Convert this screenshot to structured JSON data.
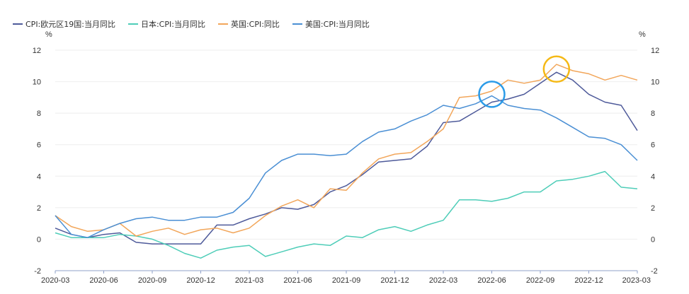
{
  "chart_data": {
    "type": "line",
    "title": "",
    "x": [
      "2020-03",
      "2020-04",
      "2020-05",
      "2020-06",
      "2020-07",
      "2020-08",
      "2020-09",
      "2020-10",
      "2020-11",
      "2020-12",
      "2021-01",
      "2021-02",
      "2021-03",
      "2021-04",
      "2021-05",
      "2021-06",
      "2021-07",
      "2021-08",
      "2021-09",
      "2021-10",
      "2021-11",
      "2021-12",
      "2022-01",
      "2022-02",
      "2022-03",
      "2022-04",
      "2022-05",
      "2022-06",
      "2022-07",
      "2022-08",
      "2022-09",
      "2022-10",
      "2022-11",
      "2022-12",
      "2023-01",
      "2023-02",
      "2023-03"
    ],
    "x_tick_labels": [
      "2020-03",
      "2020-06",
      "2020-09",
      "2020-12",
      "2021-03",
      "2021-06",
      "2021-09",
      "2021-12",
      "2022-03",
      "2022-06",
      "2022-09",
      "2022-12",
      "2023-03"
    ],
    "y_left_unit": "%",
    "y_right_unit": "%",
    "ylim": [
      -2,
      12
    ],
    "y_ticks": [
      -2,
      0,
      2,
      4,
      6,
      8,
      10,
      12
    ],
    "grid": "horizontal",
    "legend_position": "top-left",
    "series": [
      {
        "name": "CPI:欧元区19国:当月同比",
        "color": "#4e5a9a",
        "values": [
          0.7,
          0.3,
          0.1,
          0.3,
          0.4,
          -0.2,
          -0.3,
          -0.3,
          -0.3,
          -0.3,
          0.9,
          0.9,
          1.3,
          1.6,
          2.0,
          1.9,
          2.2,
          3.0,
          3.4,
          4.1,
          4.9,
          5.0,
          5.1,
          5.9,
          7.4,
          7.5,
          8.1,
          8.7,
          8.9,
          9.2,
          9.9,
          10.6,
          10.1,
          9.2,
          8.7,
          8.5,
          6.9
        ]
      },
      {
        "name": "日本:CPI:当月同比",
        "color": "#4ecdb8",
        "values": [
          0.4,
          0.1,
          0.1,
          0.1,
          0.3,
          0.2,
          0.0,
          -0.4,
          -0.9,
          -1.2,
          -0.7,
          -0.5,
          -0.4,
          -1.1,
          -0.8,
          -0.5,
          -0.3,
          -0.4,
          0.2,
          0.1,
          0.6,
          0.8,
          0.5,
          0.9,
          1.2,
          2.5,
          2.5,
          2.4,
          2.6,
          3.0,
          3.0,
          3.7,
          3.8,
          4.0,
          4.3,
          3.3,
          3.2
        ]
      },
      {
        "name": "英国:CPI:同比",
        "color": "#f2a65a",
        "values": [
          1.5,
          0.8,
          0.5,
          0.6,
          1.0,
          0.2,
          0.5,
          0.7,
          0.3,
          0.6,
          0.7,
          0.4,
          0.7,
          1.5,
          2.1,
          2.5,
          2.0,
          3.2,
          3.1,
          4.2,
          5.1,
          5.4,
          5.5,
          6.2,
          7.0,
          9.0,
          9.1,
          9.4,
          10.1,
          9.9,
          10.1,
          11.1,
          10.7,
          10.5,
          10.1,
          10.4,
          10.1
        ]
      },
      {
        "name": "美国:CPI:当月同比",
        "color": "#4a8fd4",
        "values": [
          1.5,
          0.3,
          0.1,
          0.6,
          1.0,
          1.3,
          1.4,
          1.2,
          1.2,
          1.4,
          1.4,
          1.7,
          2.6,
          4.2,
          5.0,
          5.4,
          5.4,
          5.3,
          5.4,
          6.2,
          6.8,
          7.0,
          7.5,
          7.9,
          8.5,
          8.3,
          8.6,
          9.1,
          8.5,
          8.3,
          8.2,
          7.7,
          7.1,
          6.5,
          6.4,
          6.0,
          5.0
        ]
      }
    ],
    "annotations": [
      {
        "shape": "circle",
        "color": "#2b9be8",
        "x": "2022-06",
        "y": 9.2
      },
      {
        "shape": "circle",
        "color": "#f5b916",
        "x": "2022-10",
        "y": 10.8
      }
    ]
  }
}
